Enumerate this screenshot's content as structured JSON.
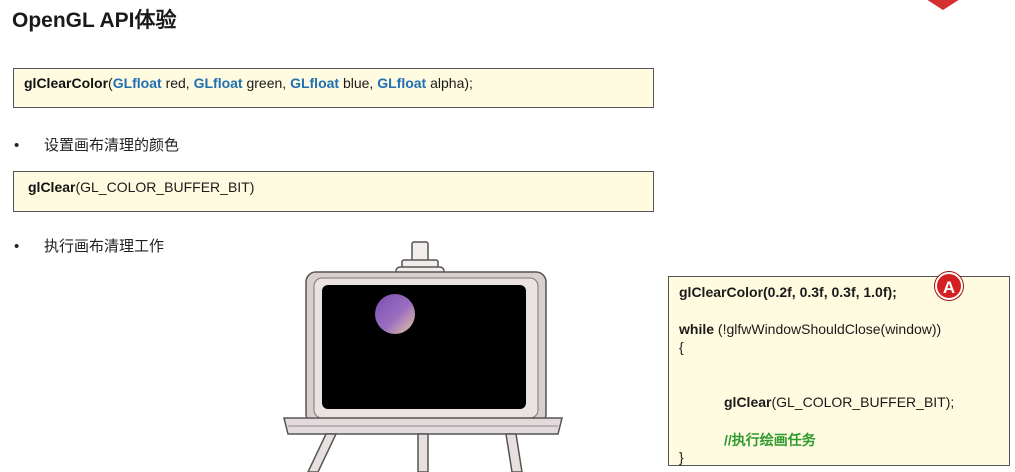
{
  "title": "OpenGL API体验",
  "code_box_1": {
    "fn": "glClearColor",
    "open": "(",
    "t1": "GLfloat",
    "p1": " red, ",
    "t2": "GLfloat",
    "p2": " green, ",
    "t3": "GLfloat",
    "p3": " blue, ",
    "t4": "GLfloat",
    "p4": " alpha);"
  },
  "bullet_1": "设置画布清理的颜色",
  "code_box_2": {
    "fn": "glClear",
    "args": "(GL_COLOR_BUFFER_BIT)"
  },
  "bullet_2": "执行画布清理工作",
  "right_code": {
    "line1": "glClearColor(0.2f, 0.3f, 0.3f, 1.0f);",
    "while_kw": "while",
    "while_rest": " (!glfwWindowShouldClose(window))",
    "open_brace": "{",
    "clear_fn": "glClear",
    "clear_args": "(GL_COLOR_BUFFER_BIT);",
    "comment": "//执行绘画任务",
    "close_brace": "}"
  },
  "badge_label": "A",
  "colors": {
    "type_keyword": "#1f6fb4",
    "comment": "#2e9a2e",
    "box_bg": "#fffbe0",
    "badge": "#d42020",
    "canvas": "#000000"
  }
}
